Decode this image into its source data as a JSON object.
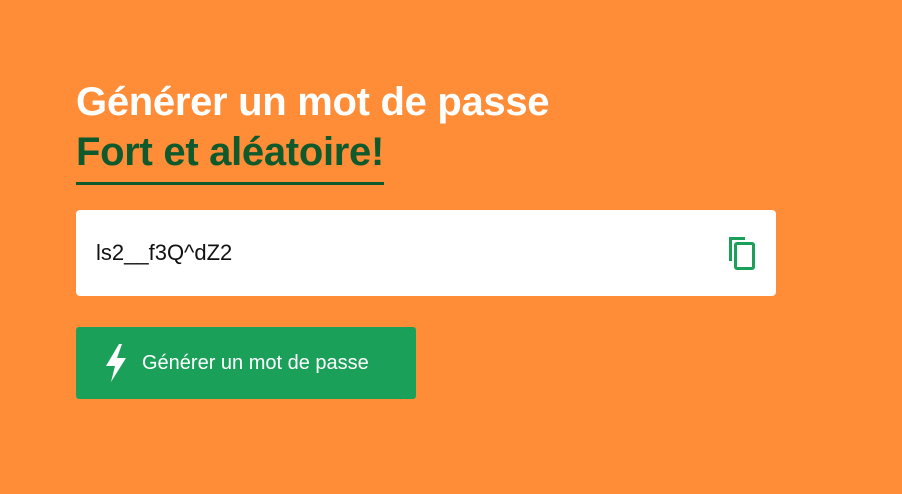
{
  "header": {
    "title_line1": "Générer un mot de passe",
    "title_line2": "Fort et aléatoire!"
  },
  "password": {
    "value": "ls2__f3Q^dZ2",
    "copy_icon": "copy-icon"
  },
  "generate": {
    "label": "Générer un mot de passe",
    "icon": "lightning-bolt-icon"
  },
  "colors": {
    "background": "#FF8C36",
    "accent_dark_green": "#0E5A2C",
    "button_green": "#1BA05A",
    "white": "#ffffff"
  }
}
